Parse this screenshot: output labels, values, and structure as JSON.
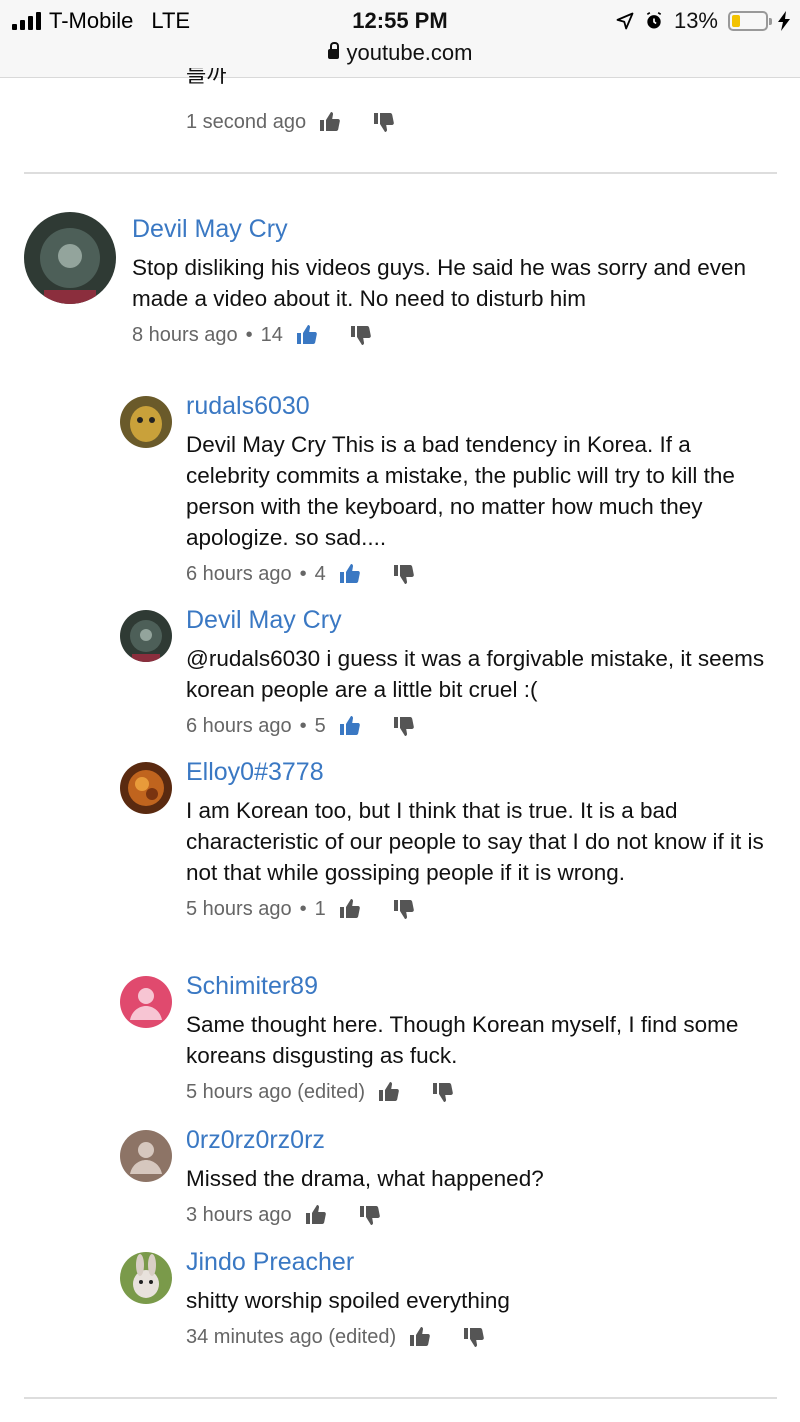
{
  "status": {
    "carrier": "T-Mobile",
    "network": "LTE",
    "time": "12:55 PM",
    "battery": "13%",
    "url": "youtube.com"
  },
  "prev_comment": {
    "text_fragment": "를까",
    "time": "1 second ago"
  },
  "comment": {
    "author": "Devil May Cry",
    "text": "Stop disliking his videos guys. He said he was sorry and even made a video about it. No need to disturb him",
    "time": "8 hours ago",
    "likes": "14"
  },
  "replies": [
    {
      "author": "rudals6030",
      "text": "Devil May Cry This is a bad tendency in Korea. If a celebrity commits a mistake, the public will try to kill the person with the keyboard, no matter how much they apologize. so sad....",
      "time": "6 hours ago",
      "likes": "4"
    },
    {
      "author": "Devil May Cry",
      "text": "@rudals6030 i guess it was a forgivable mistake, it seems korean people are a little bit cruel :(",
      "time": "6 hours ago",
      "likes": "5"
    },
    {
      "author": "Elloy0#3778",
      "text": "I am Korean too, but I think that is true. It is a bad characteristic of our people to say that I do not know if it is not that while gossiping people if it is wrong.",
      "time": "5 hours ago",
      "likes": "1"
    },
    {
      "author": "Schimiter89",
      "text": "Same thought here. Though Korean myself, I find some koreans disgusting as fuck.",
      "time": "5 hours ago (edited)",
      "likes": ""
    },
    {
      "author": "0rz0rz0rz0rz",
      "text": "Missed the drama, what happened?",
      "time": "3 hours ago",
      "likes": ""
    },
    {
      "author": "Jindo Preacher",
      "text": "shitty worship spoiled everything",
      "time": "34 minutes ago (edited)",
      "likes": ""
    }
  ],
  "colors": {
    "author_link": "#3a78c3",
    "like_active": "#3a78c3",
    "icon_grey": "#555555"
  }
}
